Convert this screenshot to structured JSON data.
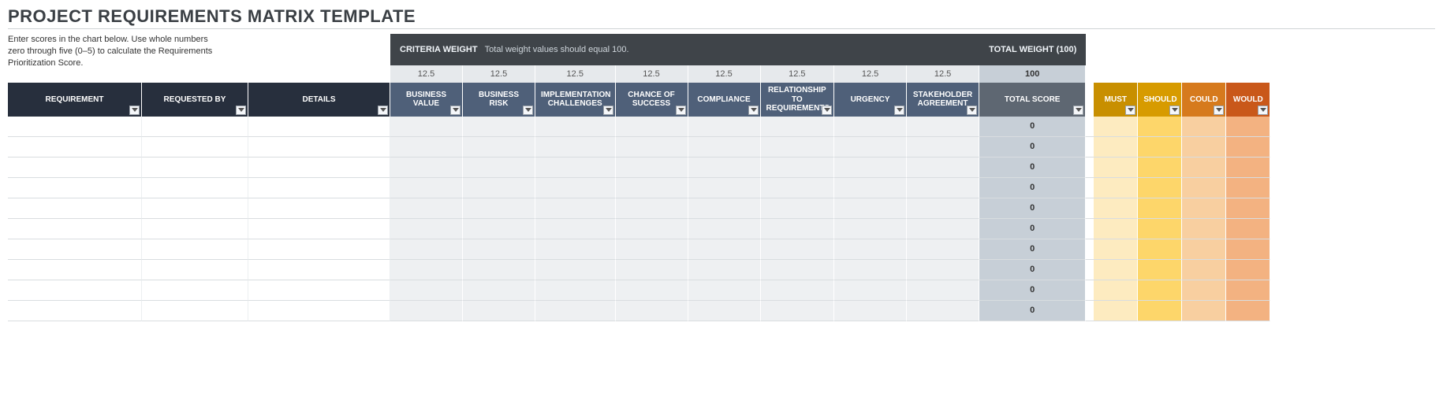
{
  "title": "PROJECT REQUIREMENTS MATRIX TEMPLATE",
  "instructions": "Enter scores in the chart below. Use whole numbers zero through five (0–5) to calculate the Requirements Prioritization Score.",
  "banner": {
    "criteria_label": "CRITERIA WEIGHT",
    "criteria_sub": "Total weight values should equal 100.",
    "total_weight_label": "TOTAL WEIGHT (100)"
  },
  "weights": [
    "12.5",
    "12.5",
    "12.5",
    "12.5",
    "12.5",
    "12.5",
    "12.5",
    "12.5"
  ],
  "weight_total": "100",
  "headers": {
    "left": [
      "REQUIREMENT",
      "REQUESTED BY",
      "DETAILS"
    ],
    "criteria": [
      "BUSINESS VALUE",
      "BUSINESS RISK",
      "IMPLEMENTATION CHALLENGES",
      "CHANCE OF SUCCESS",
      "COMPLIANCE",
      "RELATIONSHIP TO REQUIREMENTS",
      "URGENCY",
      "STAKEHOLDER AGREEMENT"
    ],
    "score": "TOTAL SCORE",
    "moscow": [
      "MUST",
      "SHOULD",
      "COULD",
      "WOULD"
    ]
  },
  "rows": [
    {
      "score": "0"
    },
    {
      "score": "0"
    },
    {
      "score": "0"
    },
    {
      "score": "0"
    },
    {
      "score": "0"
    },
    {
      "score": "0"
    },
    {
      "score": "0"
    },
    {
      "score": "0"
    },
    {
      "score": "0"
    },
    {
      "score": "0"
    }
  ]
}
